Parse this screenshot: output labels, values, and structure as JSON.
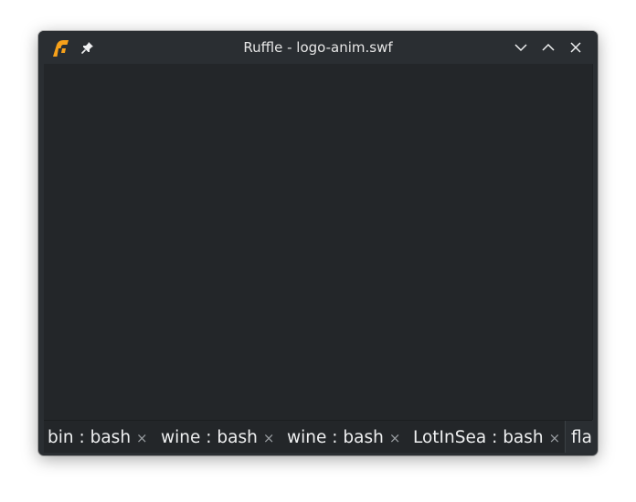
{
  "window": {
    "title": "Ruffle - logo-anim.swf",
    "icons": {
      "app": "ruffle-logo-icon",
      "pin": "pin-icon",
      "minimize": "chevron-down-icon",
      "maximize": "chevron-up-icon",
      "close": "close-icon"
    },
    "colors": {
      "titlebar": "#2a2e32",
      "content": "#232629",
      "accent": "#f7a11a"
    }
  },
  "tabs": [
    {
      "label": "bin : bash",
      "close": "×"
    },
    {
      "label": "wine : bash",
      "close": "×"
    },
    {
      "label": "wine : bash",
      "close": "×"
    },
    {
      "label": "LotInSea : bash",
      "close": "×"
    }
  ],
  "overflow_tab": {
    "label": "fla"
  }
}
